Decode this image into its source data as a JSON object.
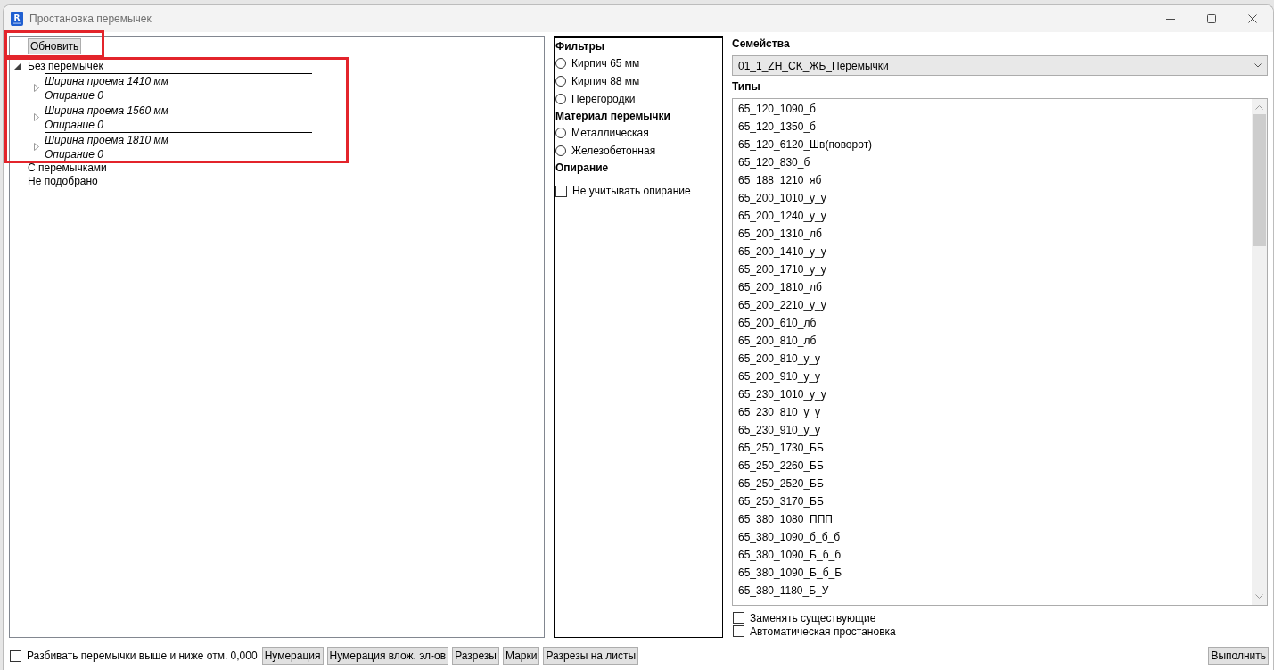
{
  "window": {
    "title": "Простановка перемычек",
    "icon_letter": "R"
  },
  "refresh_button": {
    "label": "Обновить",
    "highlighted": true
  },
  "tree": {
    "items": [
      {
        "label": "Без перемычек",
        "expanded": true,
        "highlighted": true,
        "children": [
          {
            "label": "Ширина проема 1410 мм",
            "detail": "Опирание 0",
            "expanded": false
          },
          {
            "label": "Ширина проема 1560 мм",
            "detail": "Опирание 0",
            "expanded": false
          },
          {
            "label": "Ширина проема 1810 мм",
            "detail": "Опирание 0",
            "expanded": false
          }
        ]
      },
      {
        "label": "С перемычками",
        "highlighted": false
      },
      {
        "label": "Не подобрано",
        "highlighted": false
      }
    ]
  },
  "filters": {
    "sections": [
      {
        "title": "Фильтры",
        "options": [
          {
            "kind": "radio",
            "label": "Кирпич 65 мм",
            "selected": false
          },
          {
            "kind": "radio",
            "label": "Кирпич 88 мм",
            "selected": false
          },
          {
            "kind": "radio",
            "label": "Перегородки",
            "selected": false
          }
        ]
      },
      {
        "title": "Материал перемычки",
        "options": [
          {
            "kind": "radio",
            "label": "Металлическая",
            "selected": false
          },
          {
            "kind": "radio",
            "label": "Железобетонная",
            "selected": false
          }
        ]
      },
      {
        "title": "Опирание",
        "options": [
          {
            "kind": "checkbox",
            "label": "Не учитывать опирание",
            "checked": false
          }
        ]
      }
    ]
  },
  "families": {
    "label": "Семейства",
    "value": "01_1_ZH_CK_ЖБ_Перемычки"
  },
  "types": {
    "label": "Типы",
    "items": [
      {
        "label": "65_120_1090_б",
        "selected": false
      },
      {
        "label": "65_120_1350_б",
        "selected": false
      },
      {
        "label": "65_120_6120_Шв(поворот)",
        "selected": false
      },
      {
        "label": "65_120_830_б",
        "selected": false
      },
      {
        "label": "65_188_1210_яб",
        "selected": false
      },
      {
        "label": "65_200_1010_у_у",
        "selected": false
      },
      {
        "label": "65_200_1240_у_у",
        "selected": false
      },
      {
        "label": "65_200_1310_лб",
        "selected": false
      },
      {
        "label": "65_200_1410_у_у",
        "selected": false
      },
      {
        "label": "65_200_1710_у_у",
        "selected": false
      },
      {
        "label": "65_200_1810_лб",
        "selected": false
      },
      {
        "label": "65_200_2210_у_у",
        "selected": false
      },
      {
        "label": "65_200_610_лб",
        "selected": false
      },
      {
        "label": "65_200_810_лб",
        "selected": false
      },
      {
        "label": "65_200_810_у_у",
        "selected": false
      },
      {
        "label": "65_200_910_у_у",
        "selected": false
      },
      {
        "label": "65_230_1010_у_у",
        "selected": false
      },
      {
        "label": "65_230_810_у_у",
        "selected": false
      },
      {
        "label": "65_230_910_у_у",
        "selected": false
      },
      {
        "label": "65_250_1730_ББ",
        "selected": false
      },
      {
        "label": "65_250_2260_ББ",
        "selected": false
      },
      {
        "label": "65_250_2520_ББ",
        "selected": false
      },
      {
        "label": "65_250_3170_ББ",
        "selected": false
      },
      {
        "label": "65_380_1080_ППП",
        "selected": false
      },
      {
        "label": "65_380_1090_б_б_б",
        "selected": false
      },
      {
        "label": "65_380_1090_Б_б_б",
        "selected": false
      },
      {
        "label": "65_380_1090_Б_б_Б",
        "selected": false
      },
      {
        "label": "65_380_1180_Б_У",
        "selected": false
      }
    ]
  },
  "options": [
    {
      "label": "Заменять существующие",
      "checked": false
    },
    {
      "label": "Автоматическая простановка",
      "checked": false
    }
  ],
  "bottom_bar": {
    "split_option": {
      "label": "Разбивать перемычки выше и ниже отм. 0,000",
      "checked": false
    },
    "buttons": [
      "Нумерация",
      "Нумерация влож. эл-ов",
      "Разрезы",
      "Марки",
      "Разрезы на листы"
    ],
    "run_button": "Выполнить"
  }
}
